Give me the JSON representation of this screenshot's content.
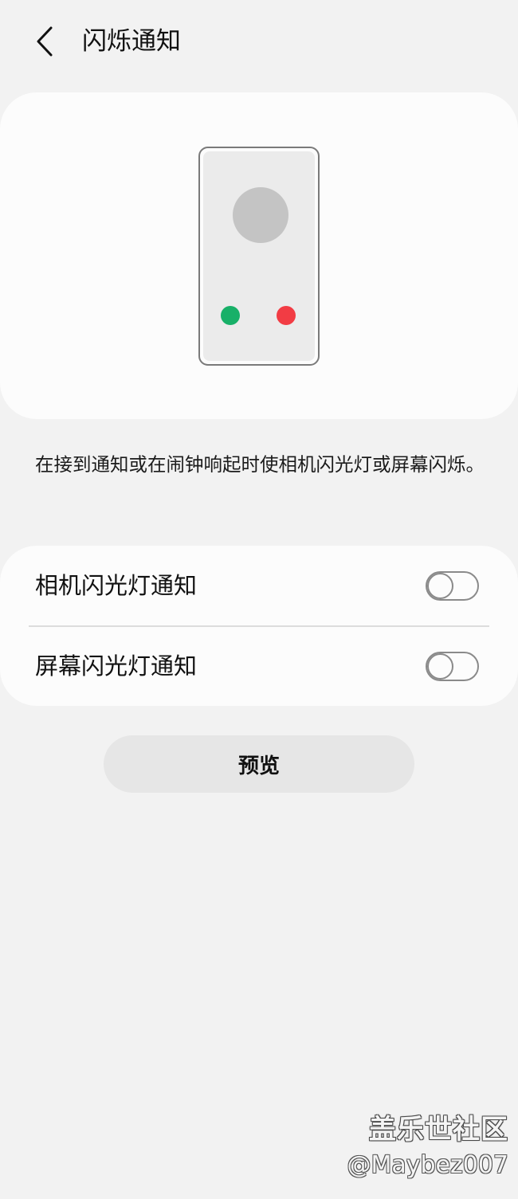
{
  "header": {
    "back_icon": "chevron-left-icon",
    "title": "闪烁通知"
  },
  "illustration": {
    "phone_icon": "incoming-call-phone",
    "avatar_color": "#c4c4c4",
    "accept_color": "#18b068",
    "decline_color": "#f23c44"
  },
  "description": "在接到通知或在闹钟响起时使相机闪光灯或屏幕闪烁。",
  "settings": [
    {
      "label": "相机闪光灯通知",
      "enabled": false
    },
    {
      "label": "屏幕闪光灯通知",
      "enabled": false
    }
  ],
  "preview_button": {
    "label": "预览"
  },
  "watermark": {
    "brand": "盖乐世社区",
    "user": "@Maybez007"
  }
}
